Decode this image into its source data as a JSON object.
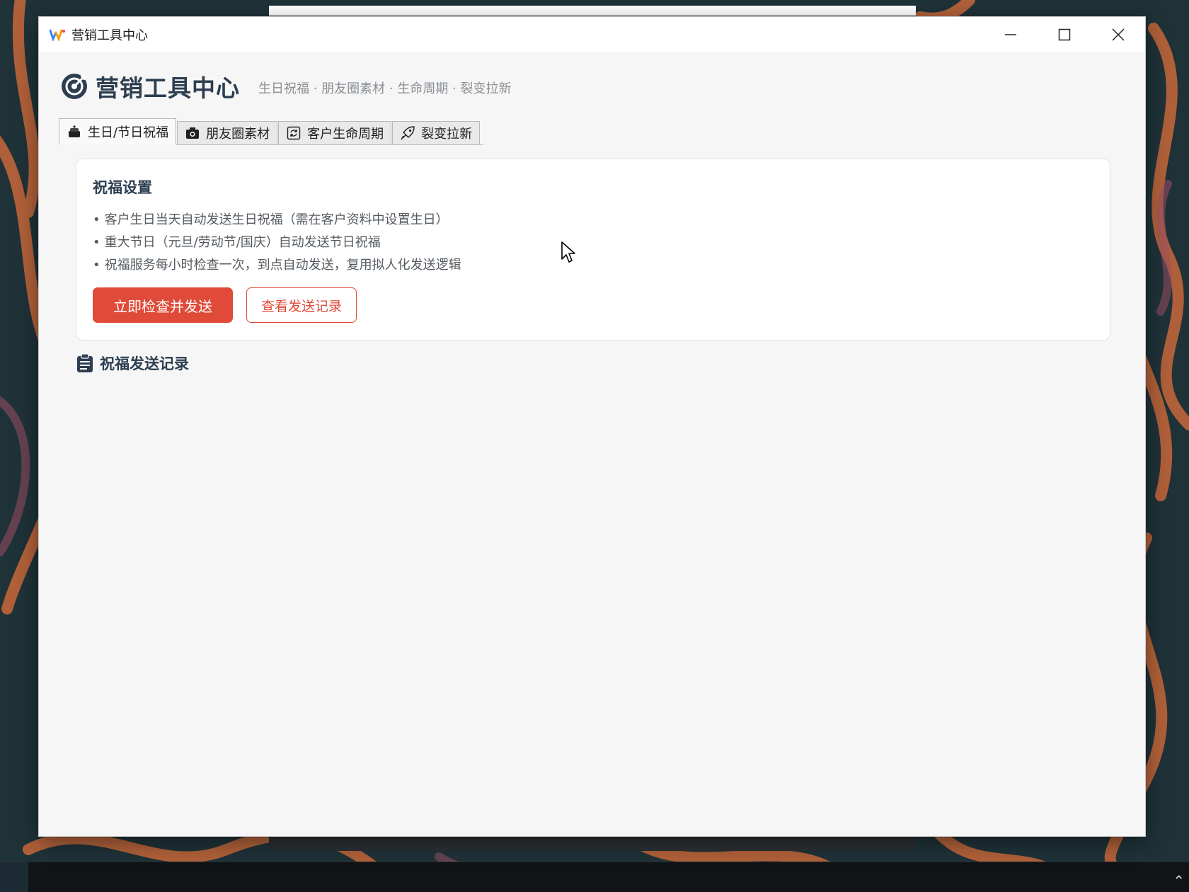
{
  "window": {
    "title": "营销工具中心"
  },
  "header": {
    "title": "营销工具中心",
    "subtitle": "生日祝福 · 朋友圈素材 · 生命周期 · 裂变拉新",
    "logo_icon": "target-icon"
  },
  "tabs": [
    {
      "label": "生日/节日祝福",
      "icon": "cake-icon",
      "active": true
    },
    {
      "label": "朋友圈素材",
      "icon": "camera-icon",
      "active": false
    },
    {
      "label": "客户生命周期",
      "icon": "cycle-icon",
      "active": false
    },
    {
      "label": "裂变拉新",
      "icon": "rocket-icon",
      "active": false
    }
  ],
  "settings_card": {
    "title": "祝福设置",
    "rules": [
      "客户生日当天自动发送生日祝福（需在客户资料中设置生日）",
      "重大节日（元旦/劳动节/国庆）自动发送节日祝福",
      "祝福服务每小时检查一次，到点自动发送，复用拟人化发送逻辑"
    ],
    "primary_button": "立即检查并发送",
    "secondary_button": "查看发送记录"
  },
  "records": {
    "title": "祝福发送记录",
    "icon": "clipboard-icon"
  },
  "colors": {
    "accent": "#e04a38",
    "heading": "#2c3e50",
    "window_bg": "#f6f6f6",
    "desktop_bg": "#1f3238"
  }
}
